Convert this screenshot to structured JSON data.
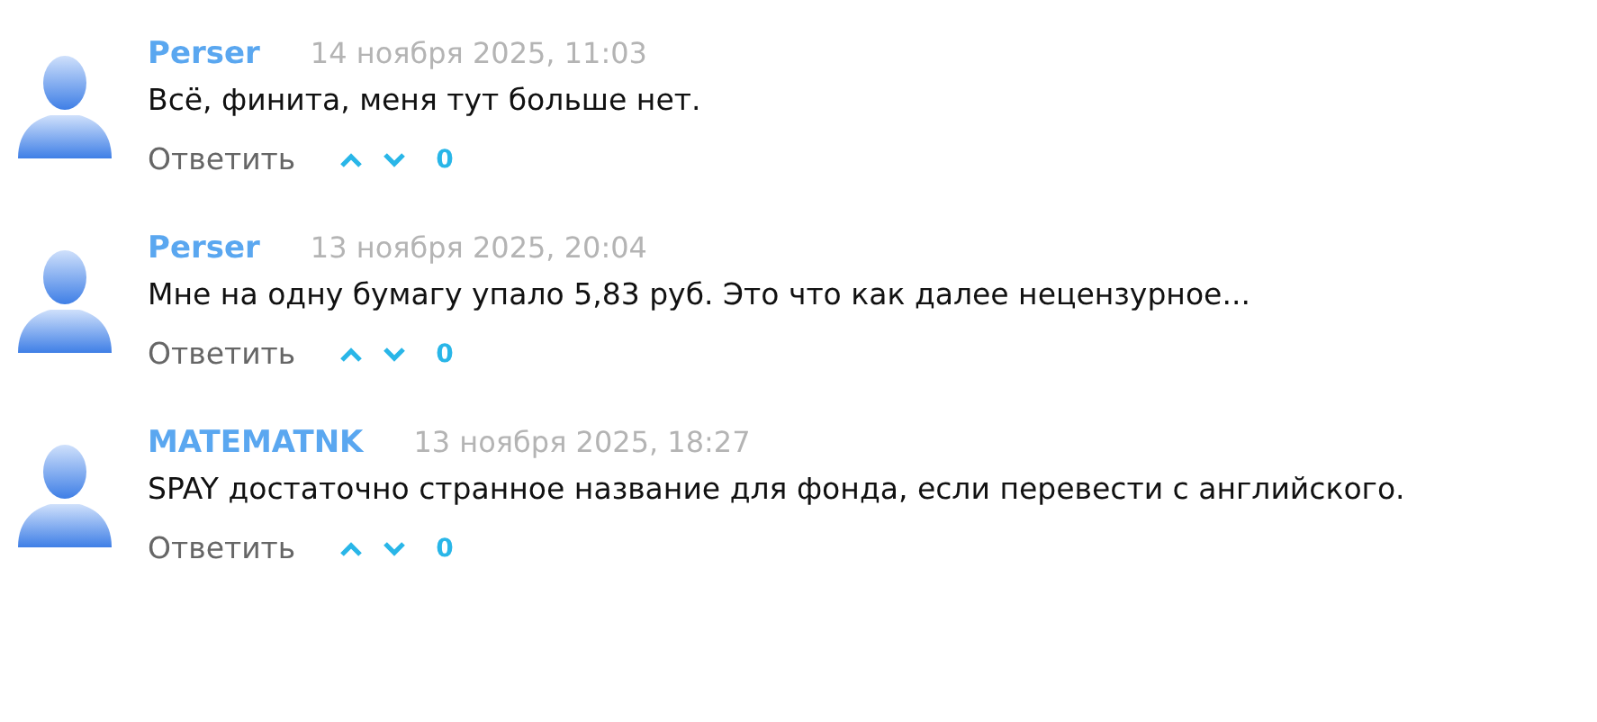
{
  "comments": [
    {
      "author": "Perser",
      "date": "14 ноября 2025, 11:03",
      "text": "Всё, финита, меня тут больше нет.",
      "reply": "Ответить",
      "score": "0"
    },
    {
      "author": "Perser",
      "date": "13 ноября 2025, 20:04",
      "text": "Мне на одну бумагу упало 5,83 руб. Это что как далее нецензурное...",
      "reply": "Ответить",
      "score": "0"
    },
    {
      "author": "MATEMATNK",
      "date": "13 ноября 2025, 18:27",
      "text": "SPAY достаточно странное название для фонда, если перевести с английского.",
      "reply": "Ответить",
      "score": "0"
    }
  ]
}
